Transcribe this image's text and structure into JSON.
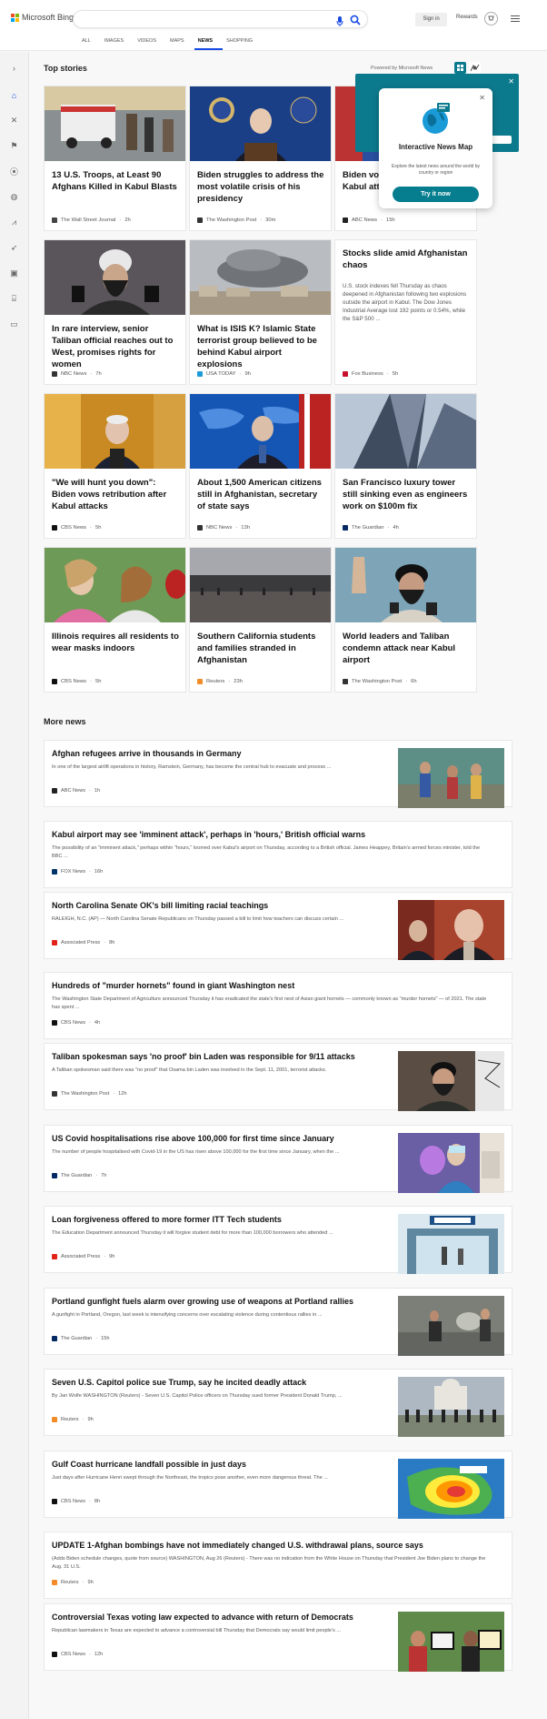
{
  "brand": {
    "name": "Microsoft Bing"
  },
  "header": {
    "sign_in": "Sign in",
    "rewards": "Rewards"
  },
  "tabs": [
    {
      "label": "ALL"
    },
    {
      "label": "IMAGES"
    },
    {
      "label": "VIDEOS"
    },
    {
      "label": "MAPS"
    },
    {
      "label": "NEWS",
      "active": true
    },
    {
      "label": "SHOPPING"
    }
  ],
  "sidebar_icons": [
    "chevron-right-icon",
    "home-icon",
    "sports-icon",
    "flag-icon",
    "location-icon",
    "globe-icon",
    "chart-icon",
    "rocket-icon",
    "film-icon",
    "bank-icon",
    "card-icon"
  ],
  "top_stories": {
    "heading": "Top stories",
    "powered_by": "Powered by Microsoft News",
    "cards": [
      {
        "title": "13 U.S. Troops, at Least 90 Afghans Killed in Kabul Blasts",
        "source": "The Wall Street Journal",
        "time": "2h",
        "logo": "#444"
      },
      {
        "title": "Biden struggles to address the most volatile crisis of his presidency",
        "source": "The Washington Post",
        "time": "30m",
        "logo": "#333"
      },
      {
        "title": "Biden vows retribution for Kabul attack after Aug...",
        "source": "ABC News",
        "time": "15h",
        "logo": "#222"
      },
      {
        "title": "In rare interview, senior Taliban official reaches out to West, promises rights for women",
        "source": "NBC News",
        "time": "7h",
        "logo": "#333"
      },
      {
        "title": "What is ISIS K? Islamic State terrorist group believed to be behind Kabul airport explosions",
        "source": "USA TODAY",
        "time": "9h",
        "logo": "#1d9bd7"
      },
      {
        "title": "Stocks slide amid Afghanistan chaos",
        "snippet": "U.S. stock indexes fell Thursday as chaos deepened in Afghanistan following two explosions outside the airport in Kabul. The Dow Jones Industrial Average lost 192 points or 0.54%, while the S&P 500 ...",
        "source": "Fox Business",
        "time": "5h",
        "logo": "#c8102e"
      },
      {
        "title": "\"We will hunt you down\": Biden vows retribution after Kabul attacks",
        "source": "CBS News",
        "time": "5h",
        "logo": "#111"
      },
      {
        "title": "About 1,500 American citizens still in Afghanistan, secretary of state says",
        "source": "NBC News",
        "time": "13h",
        "logo": "#333"
      },
      {
        "title": "San Francisco luxury tower still sinking even as engineers work on $100m fix",
        "source": "The Guardian",
        "time": "4h",
        "logo": "#052962"
      },
      {
        "title": "Illinois requires all residents to wear masks indoors",
        "source": "CBS News",
        "time": "5h",
        "logo": "#111"
      },
      {
        "title": "Southern California students and families stranded in Afghanistan",
        "source": "Reuters",
        "time": "23h",
        "logo": "#f28c28"
      },
      {
        "title": "World leaders and Taliban condemn attack near Kabul airport",
        "source": "The Washington Post",
        "time": "6h",
        "logo": "#333"
      }
    ]
  },
  "popup": {
    "title": "Interactive News Map",
    "description": "Explore the latest news around the world by country or region",
    "button": "Try it now"
  },
  "more_news": {
    "heading": "More news",
    "items": [
      {
        "title": "Afghan refugees arrive in thousands in Germany",
        "snippet": "In one of the largest airlift operations in history, Ramstein, Germany, has become the central hub to evacuate and process ...",
        "source": "ABC News",
        "time": "1h",
        "logo": "#222",
        "has_image": true
      },
      {
        "title": "Kabul airport may see 'imminent attack', perhaps in 'hours,' British official warns",
        "snippet": "The possibility of an \"imminent attack,\" perhaps within \"hours,\" loomed over Kabul's airport on Thursday, according to a British official. James Heappey, Britain's armed forces minister, told the BBC ...",
        "source": "FOX News",
        "time": "16h",
        "logo": "#003366",
        "has_image": false
      },
      {
        "title": "North Carolina Senate OK's bill limiting racial teachings",
        "snippet": "RALEIGH, N.C. (AP) — North Carolina Senate Republicans on Thursday passed a bill to limit how teachers can discuss certain ...",
        "source": "Associated Press",
        "time": "8h",
        "logo": "#e2231a",
        "has_image": true
      },
      {
        "title": "Hundreds of \"murder hornets\" found in giant Washington nest",
        "snippet": "The Washington State Department of Agriculture announced Thursday it has eradicated the state's first nest of Asian giant hornets — commonly known as \"murder hornets\" — of 2021. The state has spent ...",
        "source": "CBS News",
        "time": "4h",
        "logo": "#111",
        "has_image": false
      },
      {
        "title": "Taliban spokesman says 'no proof' bin Laden was responsible for 9/11 attacks",
        "snippet": "A Taliban spokesman said there was \"no proof\" that Osama bin Laden was involved in the Sept. 11, 2001, terrorist attacks.",
        "source": "The Washington Post",
        "time": "12h",
        "logo": "#333",
        "has_image": true
      },
      {
        "title": "US Covid hospitalisations rise above 100,000 for first time since January",
        "snippet": "The number of people hospitalised with Covid-19 in the US has risen above 100,000 for the first time since January, when the ...",
        "source": "The Guardian",
        "time": "7h",
        "logo": "#052962",
        "has_image": true
      },
      {
        "title": "Loan forgiveness offered to more former ITT Tech students",
        "snippet": "The Education Department announced Thursday it will forgive student debt for more than 100,000 borrowers who attended ...",
        "source": "Associated Press",
        "time": "9h",
        "logo": "#e2231a",
        "has_image": true
      },
      {
        "title": "Portland gunfight fuels alarm over growing use of weapons at Portland rallies",
        "snippet": "A gunfight in Portland, Oregon, last week is intensifying concerns over escalating violence during contentious rallies in ...",
        "source": "The Guardian",
        "time": "15h",
        "logo": "#052962",
        "has_image": true
      },
      {
        "title": "Seven U.S. Capitol police sue Trump, say he incited deadly attack",
        "snippet": "By Jan Wolfe WASHINGTON (Reuters) - Seven U.S. Capitol Police officers on Thursday sued former President Donald Trump, ...",
        "source": "Reuters",
        "time": "9h",
        "logo": "#f28c28",
        "has_image": true
      },
      {
        "title": "Gulf Coast hurricane landfall possible in just days",
        "snippet": "Just days after Hurricane Henri swept through the Northeast, the tropics pose another, even more dangerous threat. The ...",
        "source": "CBS News",
        "time": "8h",
        "logo": "#111",
        "has_image": true
      },
      {
        "title": "UPDATE 1-Afghan bombings have not immediately changed U.S. withdrawal plans, source says",
        "snippet": "(Adds Biden schedule changes, quote from source) WASHINGTON, Aug 26 (Reuters) - There was no indication from the White House on Thursday that President Joe Biden plans to change the Aug. 31 U.S.",
        "source": "Reuters",
        "time": "9h",
        "logo": "#f28c28",
        "has_image": false
      },
      {
        "title": "Controversial Texas voting law expected to advance with return of Democrats",
        "snippet": "Republican lawmakers in Texas are expected to advance a controversial bill Thursday that Democrats say would limit people's ...",
        "source": "CBS News",
        "time": "12h",
        "logo": "#111",
        "has_image": true
      }
    ]
  }
}
